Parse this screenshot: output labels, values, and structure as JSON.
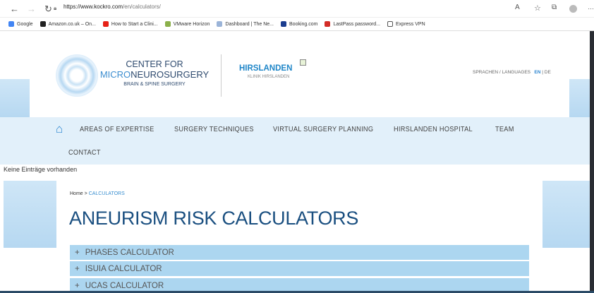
{
  "browser": {
    "url_host": "https://www.kockro.com",
    "url_path": "/en/calculators/",
    "bookmarks": [
      {
        "label": "Google",
        "color": "#4285f4"
      },
      {
        "label": "Amazon.co.uk – On...",
        "color": "#222"
      },
      {
        "label": "How to Start a Clini...",
        "color": "#e62117"
      },
      {
        "label": "VMware Horizon",
        "color": "#8bb04a"
      },
      {
        "label": "Dashboard | The Ne...",
        "color": "#9bb4d8"
      },
      {
        "label": "Booking.com",
        "color": "#1b3d8f"
      },
      {
        "label": "LastPass password...",
        "color": "#d32d27"
      },
      {
        "label": "Express VPN",
        "color": "#fff"
      }
    ]
  },
  "header": {
    "lang_label": "SPRACHEN / LANGUAGES",
    "lang_en": "EN",
    "lang_sep": "|",
    "lang_de": "DE",
    "logo_line1": "CENTER FOR",
    "logo_line2a": "MICRO",
    "logo_line2b": "NEUROSURGERY",
    "logo_line3": "BRAIN & SPINE SURGERY",
    "partner_name": "HIRSLANDEN",
    "partner_sub": "KLINIK HIRSLANDEN"
  },
  "nav": {
    "items": [
      "AREAS OF EXPERTISE",
      "SURGERY TECHNIQUES",
      "VIRTUAL SURGERY PLANNING",
      "HIRSLANDEN HOSPITAL",
      "TEAM",
      "CONTACT"
    ]
  },
  "notice": "Keine Einträge vorhanden",
  "breadcrumb": {
    "home": "Home",
    "sep": ">",
    "current": "CALCULATORS"
  },
  "title": "ANEURISM RISK CALCULATORS",
  "accordions": [
    {
      "icon": "+",
      "label": "PHASES CALCULATOR"
    },
    {
      "icon": "+",
      "label": "ISUIA CALCULATOR"
    },
    {
      "icon": "+",
      "label": "UCAS CALCULATOR"
    }
  ],
  "colors": {
    "accent": "#1a4f80",
    "link": "#3a8fd0",
    "panel": "#acd6f0"
  }
}
